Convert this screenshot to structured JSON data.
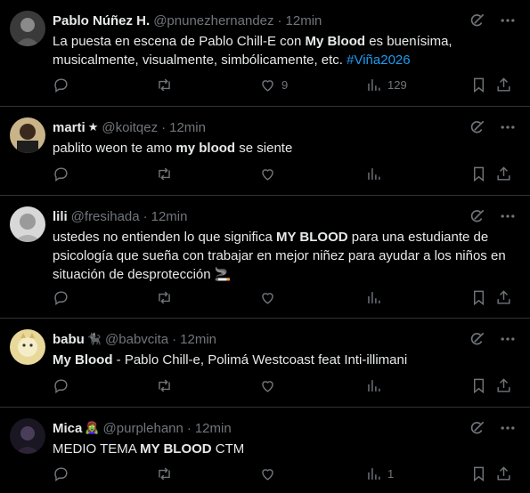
{
  "tweets": [
    {
      "name": "Pablo Núñez H.",
      "emoji": "",
      "handle": "@pnunezhernandez",
      "time": "12min",
      "text": [
        {
          "t": "La puesta en escena de Pablo Chill-E con "
        },
        {
          "t": "My Blood",
          "b": true
        },
        {
          "t": " es buenísima, musicalmente, visualmente, simbólicamente, etc. "
        },
        {
          "t": "#Viña2026",
          "tag": true
        }
      ],
      "likes": "9",
      "views": "129"
    },
    {
      "name": "marti",
      "emoji": "★",
      "handle": "@koitqez",
      "time": "12min",
      "text": [
        {
          "t": "pablito weon te amo "
        },
        {
          "t": "my blood",
          "b": true
        },
        {
          "t": " se siente"
        }
      ],
      "likes": "",
      "views": ""
    },
    {
      "name": "lili",
      "emoji": "",
      "handle": "@fresihada",
      "time": "12min",
      "text": [
        {
          "t": "ustedes no entienden lo que significa "
        },
        {
          "t": "MY BLOOD",
          "b": true
        },
        {
          "t": " para una estudiante de psicología que sueña con trabajar en mejor niñez para ayudar a los niños en situación de desprotección 🚬"
        }
      ],
      "likes": "",
      "views": ""
    },
    {
      "name": "babu",
      "emoji": "🐈‍⬛",
      "handle": "@babvcita",
      "time": "12min",
      "text": [
        {
          "t": "My Blood",
          "b": true
        },
        {
          "t": " - Pablo Chill-e, Polimá Westcoast feat Inti-illimani"
        }
      ],
      "likes": "",
      "views": ""
    },
    {
      "name": "Mica",
      "emoji": "🧟‍♀️",
      "handle": "@purplehann",
      "time": "12min",
      "text": [
        {
          "t": "MEDIO TEMA "
        },
        {
          "t": "MY BLOOD",
          "b": true
        },
        {
          "t": " CTM"
        }
      ],
      "likes": "",
      "views": "1"
    }
  ],
  "colors": {
    "background": "#000000",
    "text": "#e7e9ea",
    "muted": "#71767b",
    "link": "#1d9bf0",
    "divider": "#2f3336"
  },
  "icons": [
    "grok-icon",
    "more-icon",
    "reply-icon",
    "retweet-icon",
    "like-icon",
    "views-icon",
    "bookmark-icon",
    "share-icon"
  ]
}
